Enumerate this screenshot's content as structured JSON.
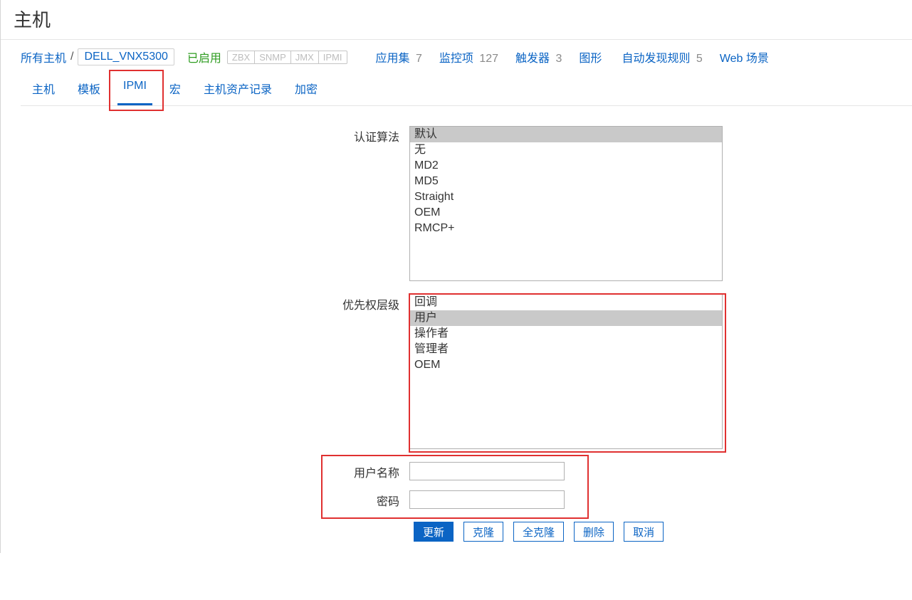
{
  "header": {
    "title": "主机"
  },
  "breadcrumb": {
    "all_hosts": "所有主机",
    "host_name": "DELL_VNX5300",
    "enabled_label": "已启用"
  },
  "interfaces": [
    "ZBX",
    "SNMP",
    "JMX",
    "IPMI"
  ],
  "nav": [
    {
      "label": "应用集",
      "count": "7"
    },
    {
      "label": "监控项",
      "count": "127"
    },
    {
      "label": "触发器",
      "count": "3"
    },
    {
      "label": "图形",
      "count": ""
    },
    {
      "label": "自动发现规则",
      "count": "5"
    },
    {
      "label": "Web 场景",
      "count": ""
    }
  ],
  "tabs": {
    "items": [
      "主机",
      "模板",
      "IPMI",
      "宏",
      "主机资产记录",
      "加密"
    ],
    "active": "IPMI"
  },
  "form": {
    "auth_label": "认证算法",
    "auth_options": [
      "默认",
      "无",
      "MD2",
      "MD5",
      "Straight",
      "OEM",
      "RMCP+"
    ],
    "auth_selected": "默认",
    "priv_label": "优先权层级",
    "priv_options": [
      "回调",
      "用户",
      "操作者",
      "管理者",
      "OEM"
    ],
    "priv_selected": "用户",
    "username_label": "用户名称",
    "username_value": "",
    "password_label": "密码",
    "password_value": ""
  },
  "buttons": {
    "update": "更新",
    "clone": "克隆",
    "full_clone": "全克隆",
    "delete": "删除",
    "cancel": "取消"
  }
}
